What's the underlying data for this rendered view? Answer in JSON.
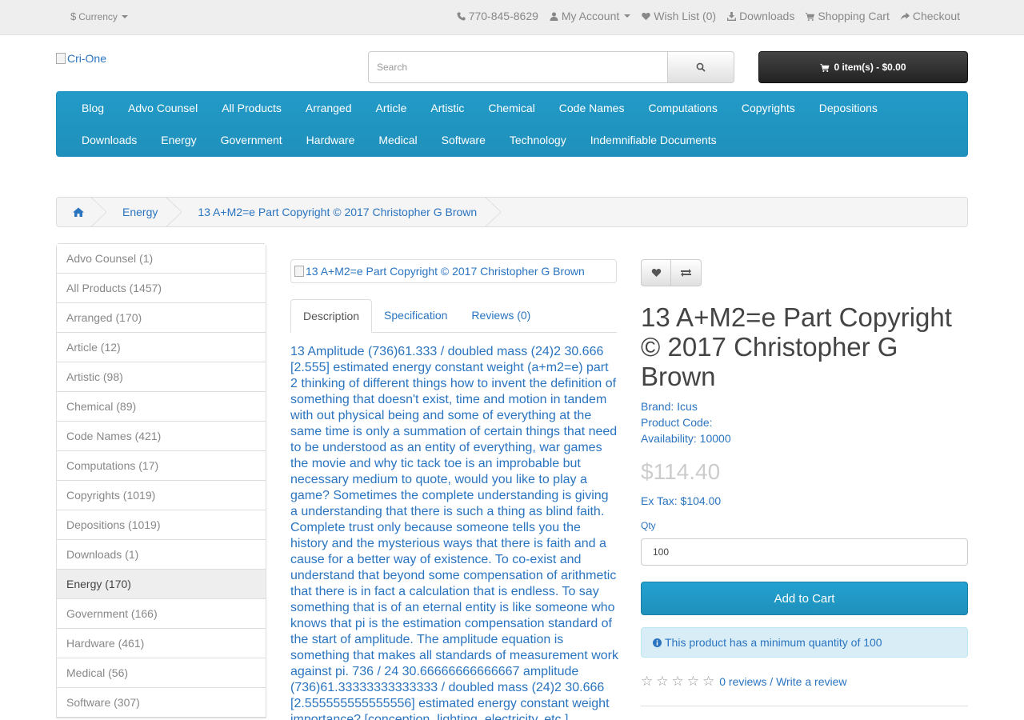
{
  "topbar": {
    "currency": "Currency",
    "phone": "770-845-8629",
    "my_account": "My Account",
    "wishlist": "Wish List (0)",
    "downloads": "Downloads",
    "shopping_cart": "Shopping Cart",
    "checkout": "Checkout"
  },
  "header": {
    "logo_alt": "Cri-One",
    "search_placeholder": "Search",
    "cart_label": "0 item(s) - $0.00"
  },
  "menu": {
    "row1": [
      "Blog",
      "Advo Counsel",
      "All Products",
      "Arranged",
      "Article",
      "Artistic",
      "Chemical",
      "Code Names",
      "Computations",
      "Copyrights",
      "Depositions"
    ],
    "row2": [
      "Downloads",
      "Energy",
      "Government",
      "Hardware",
      "Medical",
      "Software",
      "Technology",
      "Indemnifiable Documents"
    ]
  },
  "breadcrumb": {
    "category": "Energy",
    "product": "13 A+M2=e Part Copyright © 2017 Christopher G Brown"
  },
  "sidebar": {
    "items": [
      {
        "label": "Advo Counsel (1)",
        "active": false
      },
      {
        "label": "All Products (1457)",
        "active": false
      },
      {
        "label": "Arranged (170)",
        "active": false
      },
      {
        "label": "Article (12)",
        "active": false
      },
      {
        "label": "Artistic (98)",
        "active": false
      },
      {
        "label": "Chemical (89)",
        "active": false
      },
      {
        "label": "Code Names (421)",
        "active": false
      },
      {
        "label": "Computations (17)",
        "active": false
      },
      {
        "label": "Copyrights (1019)",
        "active": false
      },
      {
        "label": "Depositions (1019)",
        "active": false
      },
      {
        "label": "Downloads (1)",
        "active": false
      },
      {
        "label": "Energy (170)",
        "active": true
      },
      {
        "label": "Government (166)",
        "active": false
      },
      {
        "label": "Hardware (461)",
        "active": false
      },
      {
        "label": "Medical (56)",
        "active": false
      },
      {
        "label": "Software (307)",
        "active": false
      }
    ]
  },
  "product": {
    "image_alt": "13 A+M2=e Part Copyright © 2017 Christopher G Brown",
    "tabs": [
      "Description",
      "Specification",
      "Reviews (0)"
    ],
    "description": "13 Amplitude (736)61.333 / doubled mass (24)2 30.666 [2.555] estimated energy constant weight (a+m2=e) part 2 thinking of different things how to invent the definition of something that doesn't exist, time and motion in tandem with out physical being and some of everything at the same time is only a summation of certain things that need to be understood as an entity of everything, war games the movie and why tic tack toe is an improbable but necessary medium to quote, would you like to play a game? Sometimes the complete understanding is giving a understanding that there is such a thing as blind faith. Complete trust only because someone tells you the history and the mysterious ways that there is faith and a cause for a better way of existence. To co-exist and understand that beyond some compensation of arithmetic that there is in fact a calculation that is endless. To say something that is of an eternal entity is like someone who knows that pi is the estimation compensation standard of the start of amplitude. The amplitude equation is something that makes all standards of measurement work against pi. 736 / 24  30.66666666666667 amplitude (736)61.33333333333333 / doubled mass (24)2  30.666 [2.555555555555556] estimated energy constant weight importance? [conception, lighting, electricity, etc.]",
    "title": "13 A+M2=e Part Copyright © 2017 Christopher G Brown",
    "brand_label": "Brand:",
    "brand": "Icus",
    "product_code_label": "Product Code:",
    "product_code": "",
    "availability_label": "Availability:",
    "availability": "10000",
    "price": "$114.40",
    "ex_tax": "Ex Tax: $104.00",
    "qty_label": "Qty",
    "qty_value": "100",
    "add_to_cart": "Add to Cart",
    "min_qty_alert": "This product has a minimum quantity of 100",
    "reviews_link": "0 reviews",
    "write_review": "Write a review",
    "rating": 0
  },
  "colors": {
    "accent": "#229ac8",
    "link": "#2a74c0",
    "topbar_bg": "#eeeeee",
    "cart_bg": "#303030"
  }
}
